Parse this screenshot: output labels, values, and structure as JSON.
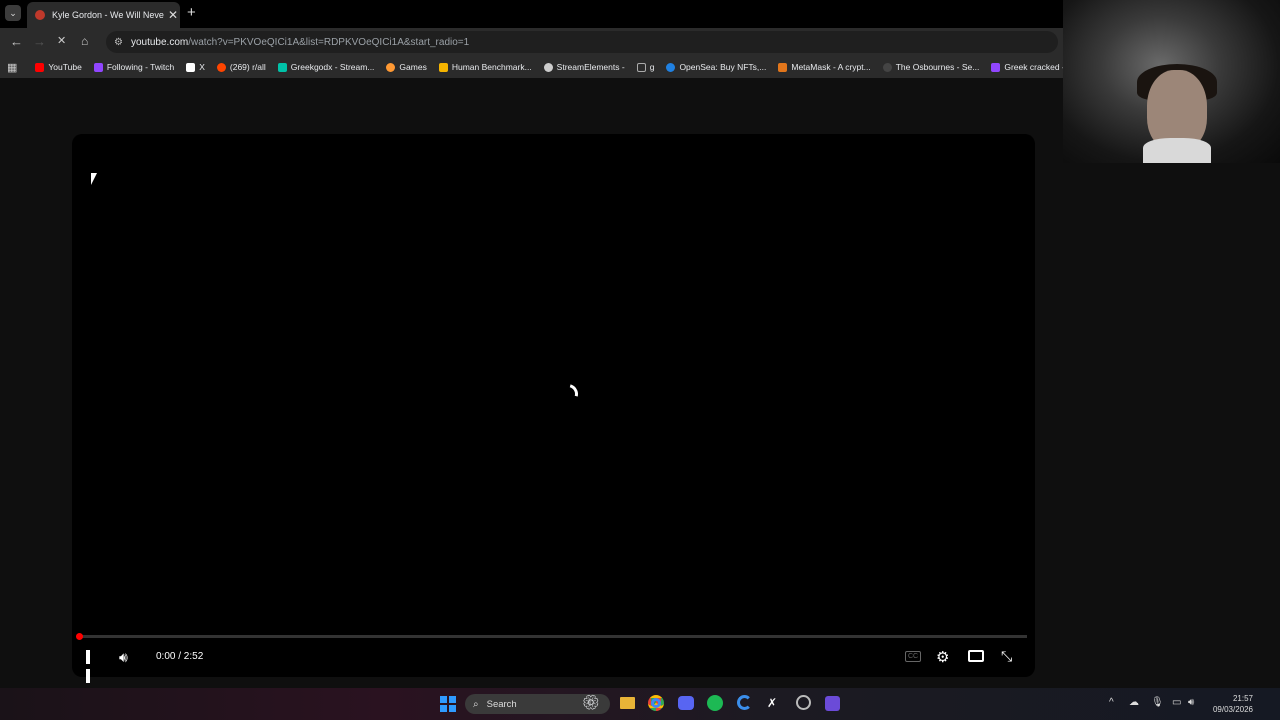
{
  "tab": {
    "title": "Kyle Gordon - We Will Never D..."
  },
  "address": {
    "host": "youtube.com",
    "path": "/watch?v=PKVOeQICi1A&list=RDPKVOeQICi1A&start_radio=1"
  },
  "bookmarks": [
    {
      "label": "YouTube",
      "color": "#ff0000"
    },
    {
      "label": "Following - Twitch",
      "color": "#9146ff"
    },
    {
      "label": "X",
      "color": "#ffffff"
    },
    {
      "label": "(269) r/all",
      "color": "#ff4500"
    },
    {
      "label": "Greekgodx - Stream...",
      "color": "#00c2a8"
    },
    {
      "label": "Games",
      "color": "#ff9933"
    },
    {
      "label": "Human Benchmark...",
      "color": "#f5b400"
    },
    {
      "label": "StreamElements -",
      "color": "#cccccc"
    },
    {
      "label": "g",
      "color": "#888888"
    },
    {
      "label": "OpenSea: Buy NFTs,...",
      "color": "#2081e2"
    },
    {
      "label": "MetaMask - A crypt...",
      "color": "#e2761b"
    },
    {
      "label": "The Osbournes - Se...",
      "color": "#444444"
    },
    {
      "label": "Greek cracked - Twi...",
      "color": "#9146ff"
    }
  ],
  "player": {
    "time": "0:00 / 2:52",
    "cc_label": "CC",
    "progress": 0.0
  },
  "taskbar": {
    "search_label": "Search",
    "time": "21:57",
    "date": "09/03/2026"
  }
}
